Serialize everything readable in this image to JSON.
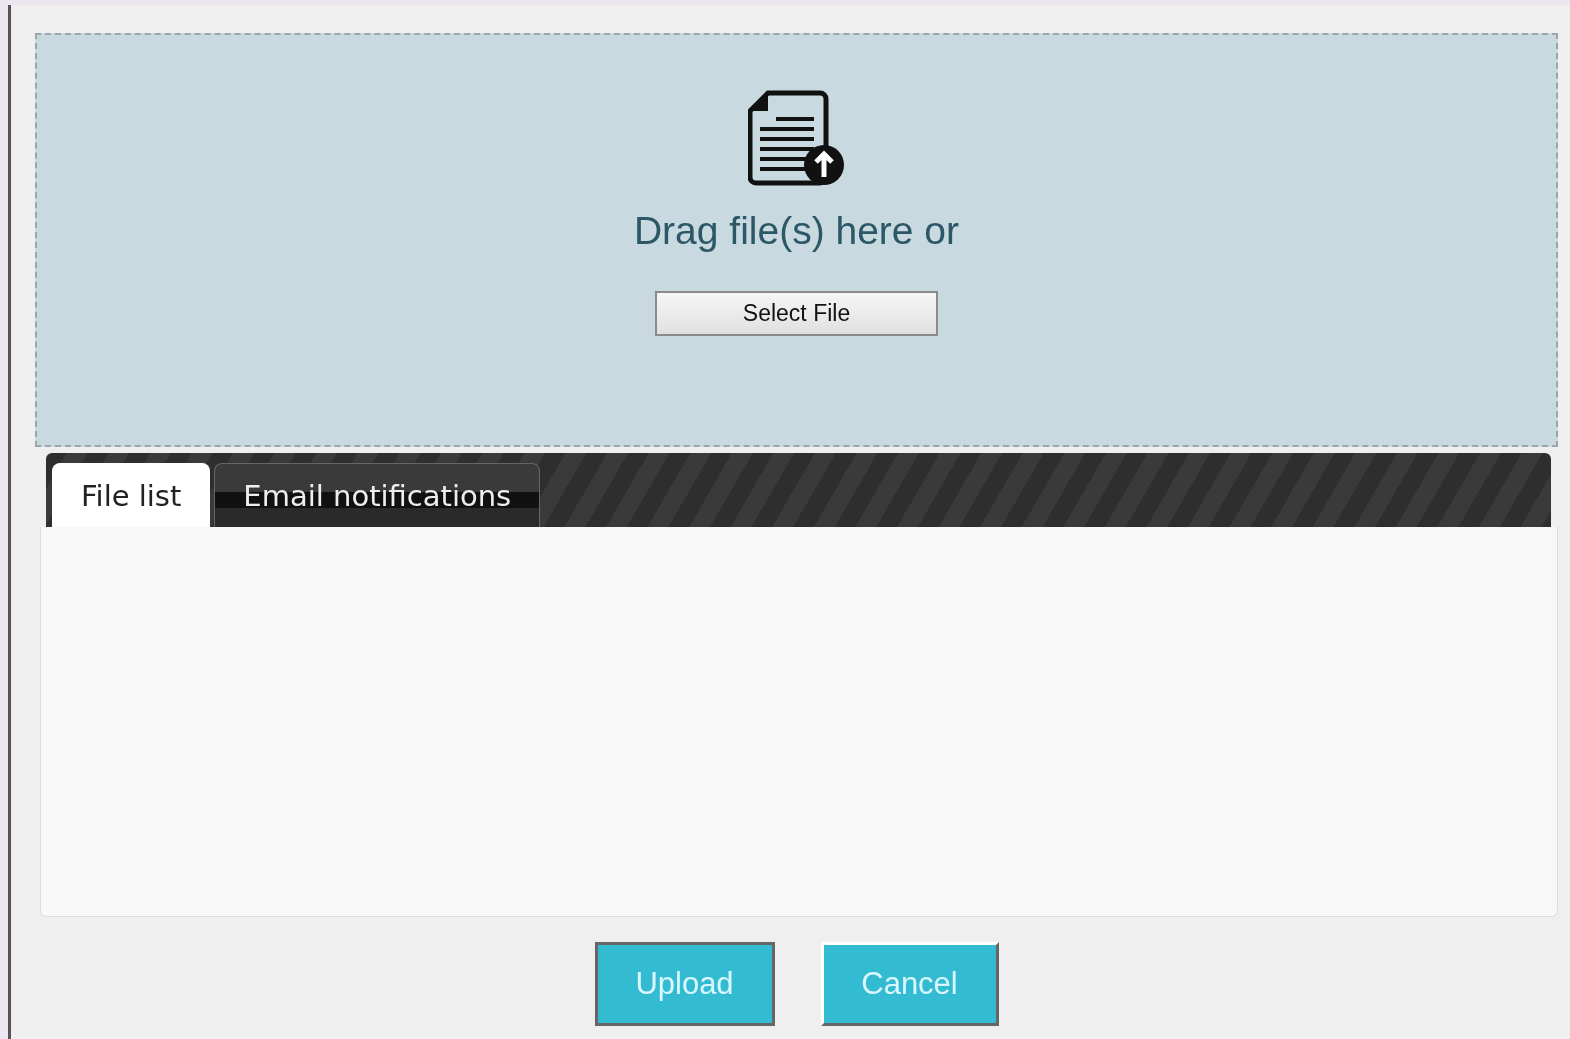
{
  "drop_zone": {
    "prompt": "Drag file(s) here or",
    "select_button": "Select File"
  },
  "tabs": [
    {
      "label": "File list",
      "selected": true
    },
    {
      "label": "Email notifications",
      "selected": false
    }
  ],
  "buttons": [
    {
      "label": "Upload",
      "focused": true
    },
    {
      "label": "Cancel",
      "focused": false
    }
  ]
}
